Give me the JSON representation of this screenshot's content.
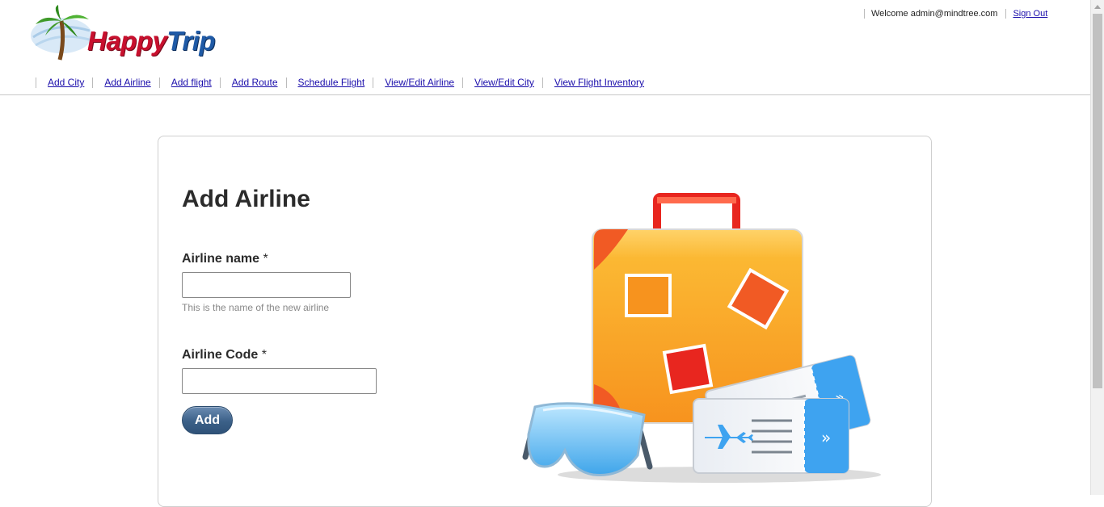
{
  "brand": {
    "part1": "Happy",
    "part2": "Trip"
  },
  "header": {
    "welcome": "Welcome admin@mindtree.com",
    "signout": "Sign Out"
  },
  "nav": [
    {
      "label": "Add City"
    },
    {
      "label": "Add Airline"
    },
    {
      "label": "Add flight"
    },
    {
      "label": "Add Route"
    },
    {
      "label": "Schedule Flight"
    },
    {
      "label": "View/Edit Airline"
    },
    {
      "label": "View/Edit City"
    },
    {
      "label": "View Flight Inventory"
    }
  ],
  "form": {
    "title": "Add Airline",
    "airline_name_label": "Airline name",
    "airline_name_value": "",
    "airline_name_hint": "This is the name of the new airline",
    "airline_code_label": "Airline Code",
    "airline_code_value": "",
    "required_marker": "*",
    "submit_label": "Add"
  },
  "colors": {
    "link": "#1a0dab",
    "button": "#3b6088",
    "suitcase": "#f7a21b",
    "ticket": "#3ea3f0"
  },
  "icons": [
    "palm-tree-logo-icon",
    "suitcase-illustration",
    "sunglasses-illustration",
    "ticket-illustration",
    "airplane-icon"
  ]
}
